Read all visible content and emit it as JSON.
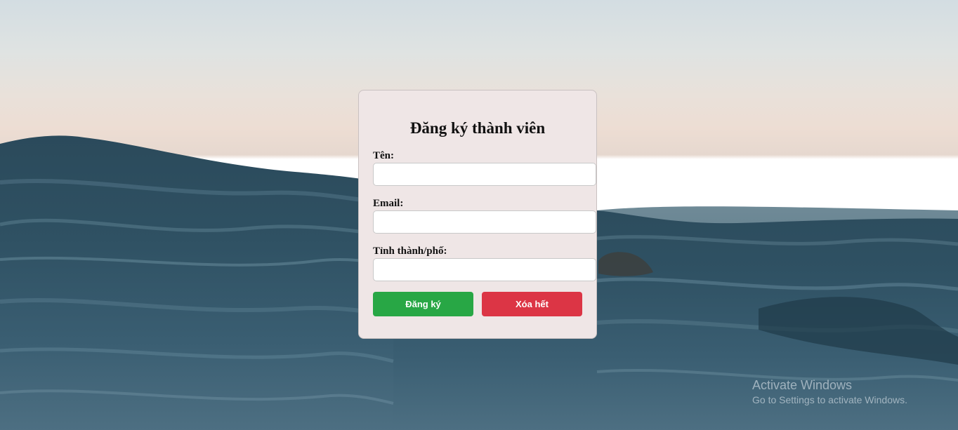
{
  "form": {
    "title": "Đăng ký thành viên",
    "name_label": "Tên:",
    "name_value": "",
    "email_label": "Email:",
    "email_value": "",
    "city_label": "Tỉnh thành/phố:",
    "city_value": "",
    "register_label": "Đăng ký",
    "clear_label": "Xóa hết"
  },
  "watermark": {
    "title": "Activate Windows",
    "subtitle": "Go to Settings to activate Windows."
  },
  "colors": {
    "card_background": "#efe6e6",
    "register_button": "#28a745",
    "clear_button": "#dc3545",
    "sky": "#d3dde2",
    "sea": "#2f4c5c"
  }
}
